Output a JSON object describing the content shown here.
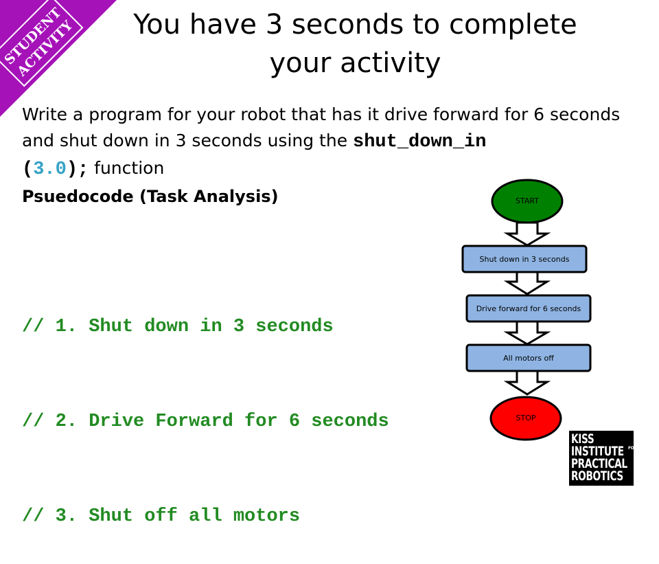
{
  "corner_banner": {
    "line1": "STUDENT",
    "line2": "ACTIVITY",
    "color": "#a512b8"
  },
  "title": {
    "line1": "You have 3 seconds to complete",
    "line2": "your activity"
  },
  "instructions": {
    "text_before": "Write a program for your robot that has it drive forward for 6 seconds and shut down in 3 seconds using the ",
    "code_fn": "shut_down_in",
    "code_open": "(",
    "code_arg": "3.0",
    "code_close": ");",
    "text_after": " function"
  },
  "pseudocode": {
    "heading": "Psuedocode (Task Analysis)",
    "lines": [
      "// 1. Shut down in 3 seconds",
      "// 2. Drive Forward for 6 seconds",
      "// 3. Shut off all motors"
    ],
    "color": "#228b22"
  },
  "flowchart": {
    "start": "START",
    "steps": [
      "Shut down in 3 seconds",
      "Drive forward for 6 seconds",
      "All motors off"
    ],
    "stop": "STOP",
    "start_color": "#008000",
    "step_color": "#8fb4e3",
    "stop_color": "#ff0000"
  },
  "logo": {
    "line1": "KISS",
    "line2": "INSTITUTE",
    "for": "FOR",
    "line3": "PRACTICAL",
    "line4": "ROBOTICS"
  }
}
